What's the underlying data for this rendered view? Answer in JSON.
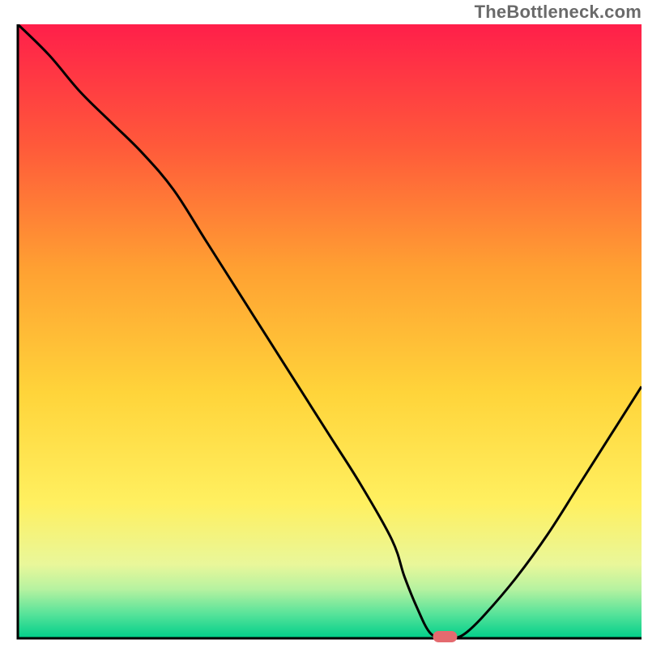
{
  "watermark_text": "TheBottleneck.com",
  "chart_data": {
    "type": "line",
    "title": "",
    "xlabel": "",
    "ylabel": "",
    "xlim": [
      0,
      100
    ],
    "ylim": [
      0,
      100
    ],
    "x": [
      0,
      5,
      10,
      15,
      20,
      25,
      30,
      35,
      40,
      45,
      50,
      55,
      60,
      62,
      64,
      66,
      68,
      70,
      72,
      75,
      80,
      85,
      90,
      95,
      100
    ],
    "values": [
      100,
      95,
      89,
      84,
      79,
      73,
      65,
      57,
      49,
      41,
      33,
      25,
      16,
      10,
      5,
      1,
      0,
      0,
      1,
      4,
      10,
      17,
      25,
      33,
      41
    ],
    "marker": {
      "x": 68.5,
      "y": 0
    },
    "gradient_stops": [
      {
        "offset": 0.0,
        "color": "#ff1f4a"
      },
      {
        "offset": 0.2,
        "color": "#ff5a3a"
      },
      {
        "offset": 0.4,
        "color": "#ffa132"
      },
      {
        "offset": 0.6,
        "color": "#ffd43a"
      },
      {
        "offset": 0.78,
        "color": "#fff060"
      },
      {
        "offset": 0.88,
        "color": "#e9f79a"
      },
      {
        "offset": 0.92,
        "color": "#b6f2a0"
      },
      {
        "offset": 0.96,
        "color": "#58e39a"
      },
      {
        "offset": 1.0,
        "color": "#00cf8a"
      }
    ],
    "axis_color": "#000000",
    "line_color": "#000000",
    "marker_color": "#e46a6f"
  }
}
